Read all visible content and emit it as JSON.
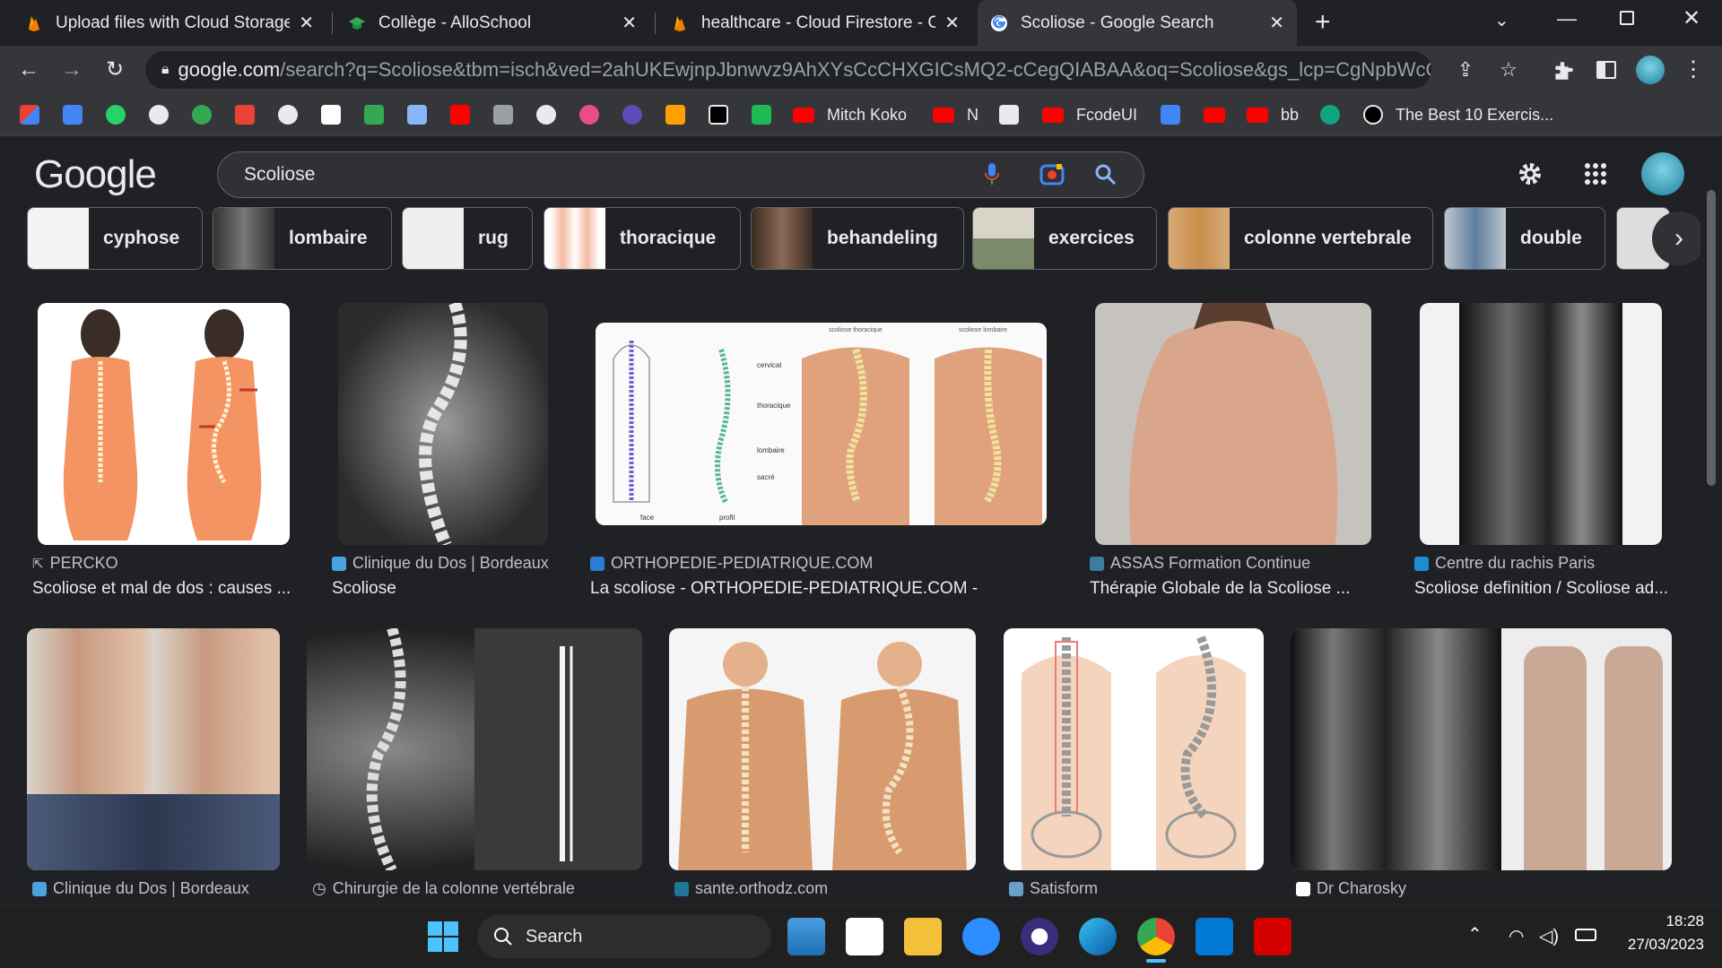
{
  "tabs": [
    {
      "title": "Upload files with Cloud Storage c",
      "favicon": "firebase-icon"
    },
    {
      "title": "Collège - AlloSchool",
      "favicon": "graduation-cap-icon"
    },
    {
      "title": "healthcare - Cloud Firestore - Co",
      "favicon": "firebase-icon"
    },
    {
      "title": "Scoliose - Google Search",
      "favicon": "google-icon",
      "active": true
    }
  ],
  "new_tab_label": "+",
  "address": {
    "host": "google.com",
    "path": "/search?q=Scoliose&tbm=isch&ved=2ahUKEwjnpJbnwvz9AhXYsCcCHXGICsMQ2-cCegQIABAA&oq=Scoliose&gs_lcp=CgNpbWcQAzIFC..."
  },
  "bookmarks": [
    {
      "label": "Mitch Koko",
      "icon": "youtube-icon"
    },
    {
      "label": "N",
      "icon": "youtube-icon"
    },
    {
      "label": "FcodeUI",
      "icon": "youtube-icon"
    },
    {
      "label": "bb",
      "icon": "youtube-icon"
    },
    {
      "label": "The Best 10 Exercis...",
      "icon": "site-icon"
    }
  ],
  "google": {
    "logo": "Google",
    "query": "Scoliose"
  },
  "chips": [
    "cyphose",
    "lombaire",
    "rug",
    "thoracique",
    "behandeling",
    "exercices",
    "colonne vertebrale",
    "double"
  ],
  "results_row1": [
    {
      "source": "PERCKO",
      "caption": "Scoliose et mal de dos : causes ..."
    },
    {
      "source": "Clinique du Dos | Bordeaux",
      "caption": "Scoliose"
    },
    {
      "source": "ORTHOPEDIE-PEDIATRIQUE.COM",
      "caption": "La scoliose - ORTHOPEDIE-PEDIATRIQUE.COM -"
    },
    {
      "source": "ASSAS Formation Continue",
      "caption": "Thérapie Globale de la Scoliose ..."
    },
    {
      "source": "Centre du rachis Paris",
      "caption": "Scoliose definition / Scoliose ad..."
    }
  ],
  "results_row2": [
    {
      "source": "Clinique du Dos | Bordeaux"
    },
    {
      "source": "Chirurgie de la colonne vertébrale"
    },
    {
      "source": "sante.orthodz.com"
    },
    {
      "source": "Satisform"
    },
    {
      "source": "Dr Charosky"
    }
  ],
  "diagram_labels": {
    "left_top": "scoliose thoracique",
    "right_top": "scoliose lombaire",
    "cervical": "cervical",
    "thoracique": "thoracique",
    "lombaire": "lombaire",
    "sacre": "sacré",
    "face": "face",
    "profil": "profil"
  },
  "taskbar": {
    "search_label": "Search",
    "time": "18:28",
    "date": "27/03/2023"
  },
  "colors": {
    "accent_blue": "#8ab4f8",
    "youtube_red": "#ff0000",
    "skin": "#f0a070"
  }
}
